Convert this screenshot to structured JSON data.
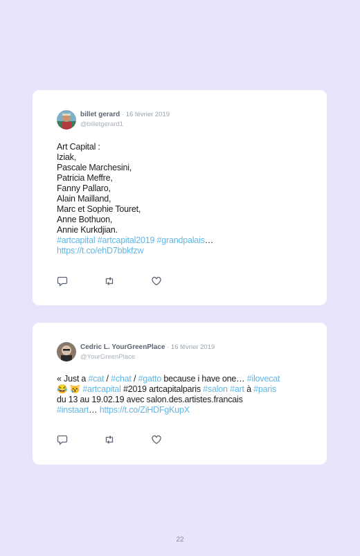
{
  "tweets": [
    {
      "name": "billet gerard",
      "date": " · 16 février 2019",
      "handle": "@billetgerard1",
      "lines": [
        [
          {
            "t": "Art Capital :"
          }
        ],
        [
          {
            "t": "Iziak,"
          }
        ],
        [
          {
            "t": "Pascale Marchesini,"
          }
        ],
        [
          {
            "t": "Patricia Meffre,"
          }
        ],
        [
          {
            "t": "Fanny Pallaro,"
          }
        ],
        [
          {
            "t": "Alain Mailland,"
          }
        ],
        [
          {
            "t": "Marc et Sophie Touret,"
          }
        ],
        [
          {
            "t": "Anne Bothuon,"
          }
        ],
        [
          {
            "t": "Annie Kurkdjian."
          }
        ],
        [
          {
            "t": "#artcapital #artcapital2019 #grandpalais",
            "link": true
          },
          {
            "t": "…"
          }
        ],
        [
          {
            "t": "https://t.co/ehD7bbkfzw",
            "link": true
          }
        ]
      ]
    },
    {
      "name": "Cedric L. YourGreenPlace",
      "date": " · 16 février 2019",
      "handle": "@YourGreenPlace",
      "lines": [
        [
          {
            "t": "« Just a "
          },
          {
            "t": "#cat",
            "link": true
          },
          {
            "t": " / "
          },
          {
            "t": "#chat",
            "link": true
          },
          {
            "t": " / "
          },
          {
            "t": "#gatto",
            "link": true
          },
          {
            "t": " because i have one… "
          },
          {
            "t": "#ilovecat",
            "link": true
          }
        ],
        [
          {
            "t": "😂 😿 "
          },
          {
            "t": "#artcapital",
            "link": true
          },
          {
            "t": " #2019 artcapitalparis "
          },
          {
            "t": "#salon",
            "link": true
          },
          {
            "t": " "
          },
          {
            "t": "#art",
            "link": true
          },
          {
            "t": " à "
          },
          {
            "t": "#paris",
            "link": true
          }
        ],
        [
          {
            "t": "du 13 au 19.02.19 avec salon.des.artistes.francais"
          }
        ],
        [
          {
            "t": "#instaart",
            "link": true
          },
          {
            "t": "… "
          },
          {
            "t": "https://t.co/ZiHDFgKupX",
            "link": true
          }
        ]
      ]
    }
  ],
  "icons": {
    "reply": "reply-icon",
    "retweet": "retweet-icon",
    "like": "heart-icon"
  },
  "page_number": "22"
}
